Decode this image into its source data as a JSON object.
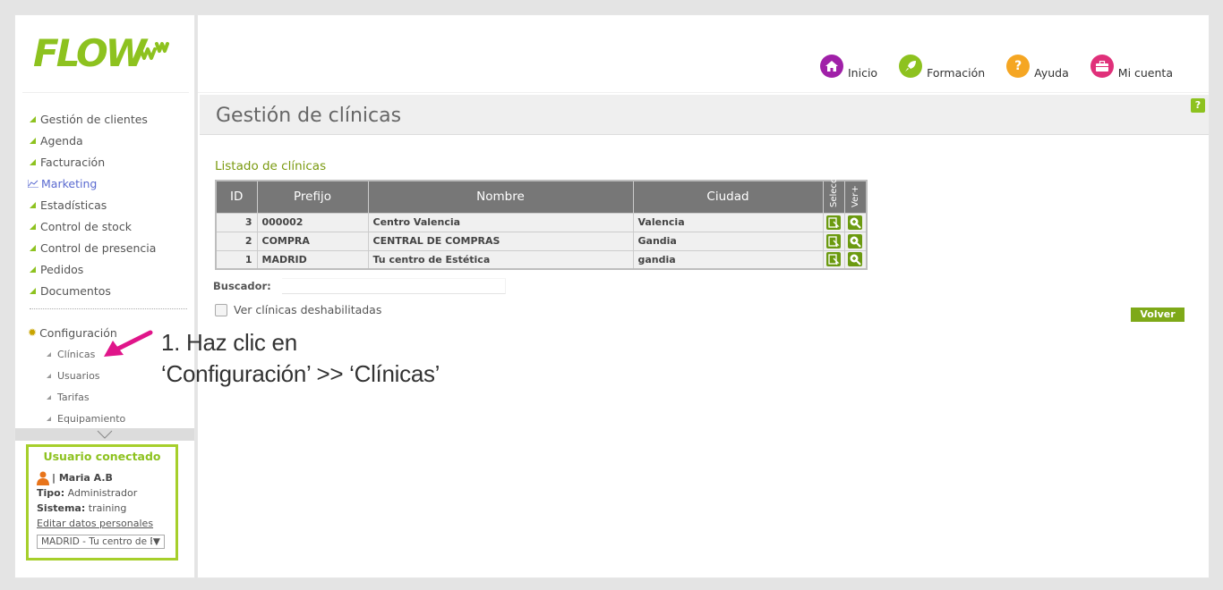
{
  "logo": {
    "text": "FLOW",
    "color": "#8dc21f"
  },
  "menu": {
    "items": [
      {
        "label": "Gestión de clientes"
      },
      {
        "label": "Agenda"
      },
      {
        "label": "Facturación"
      },
      {
        "label": "Marketing"
      },
      {
        "label": "Estadísticas"
      },
      {
        "label": "Control de stock"
      },
      {
        "label": "Control de presencia"
      },
      {
        "label": "Pedidos"
      },
      {
        "label": "Documentos"
      }
    ],
    "config_label": "Configuración",
    "submenu": [
      {
        "label": "Clínicas"
      },
      {
        "label": "Usuarios"
      },
      {
        "label": "Tarifas"
      },
      {
        "label": "Equipamiento"
      }
    ]
  },
  "user": {
    "title": "Usuario conectado",
    "name": "| Maria A.B",
    "tipo_label": "Tipo:",
    "tipo_value": "Administrador",
    "sistema_label": "Sistema:",
    "sistema_value": "training",
    "edit_link": "Editar datos personales",
    "clinic_select": "MADRID - Tu centro de Estética"
  },
  "topnav": [
    {
      "label": "Inicio",
      "icon": "home-icon",
      "color": "#a020a8"
    },
    {
      "label": "Formación",
      "icon": "rocket-icon",
      "color": "#8dc21f"
    },
    {
      "label": "Ayuda",
      "icon": "question-icon",
      "color": "#f5a623"
    },
    {
      "label": "Mi cuenta",
      "icon": "briefcase-icon",
      "color": "#e0307a"
    }
  ],
  "page": {
    "title": "Gestión de clínicas",
    "help": "?",
    "list_title": "Listado de clínicas"
  },
  "table": {
    "headers": [
      "ID",
      "Prefijo",
      "Nombre",
      "Ciudad",
      "Selecci",
      "Ver+"
    ],
    "rows": [
      {
        "id": "3",
        "prefijo": "000002",
        "nombre": "Centro Valencia",
        "ciudad": "Valencia"
      },
      {
        "id": "2",
        "prefijo": "COMPRA",
        "nombre": "CENTRAL DE COMPRAS",
        "ciudad": "Gandia"
      },
      {
        "id": "1",
        "prefijo": "MADRID",
        "nombre": "Tu centro de Estética",
        "ciudad": "gandia"
      }
    ]
  },
  "search": {
    "label": "Buscador:",
    "value": ""
  },
  "checkbox": {
    "label": "Ver clínicas deshabilitadas",
    "checked": false
  },
  "volver_label": "Volver",
  "annotation": {
    "line1": "1. Haz clic en",
    "line2": "‘Configuración’ >> ‘Clínicas’",
    "arrow_color": "#e0158a"
  }
}
